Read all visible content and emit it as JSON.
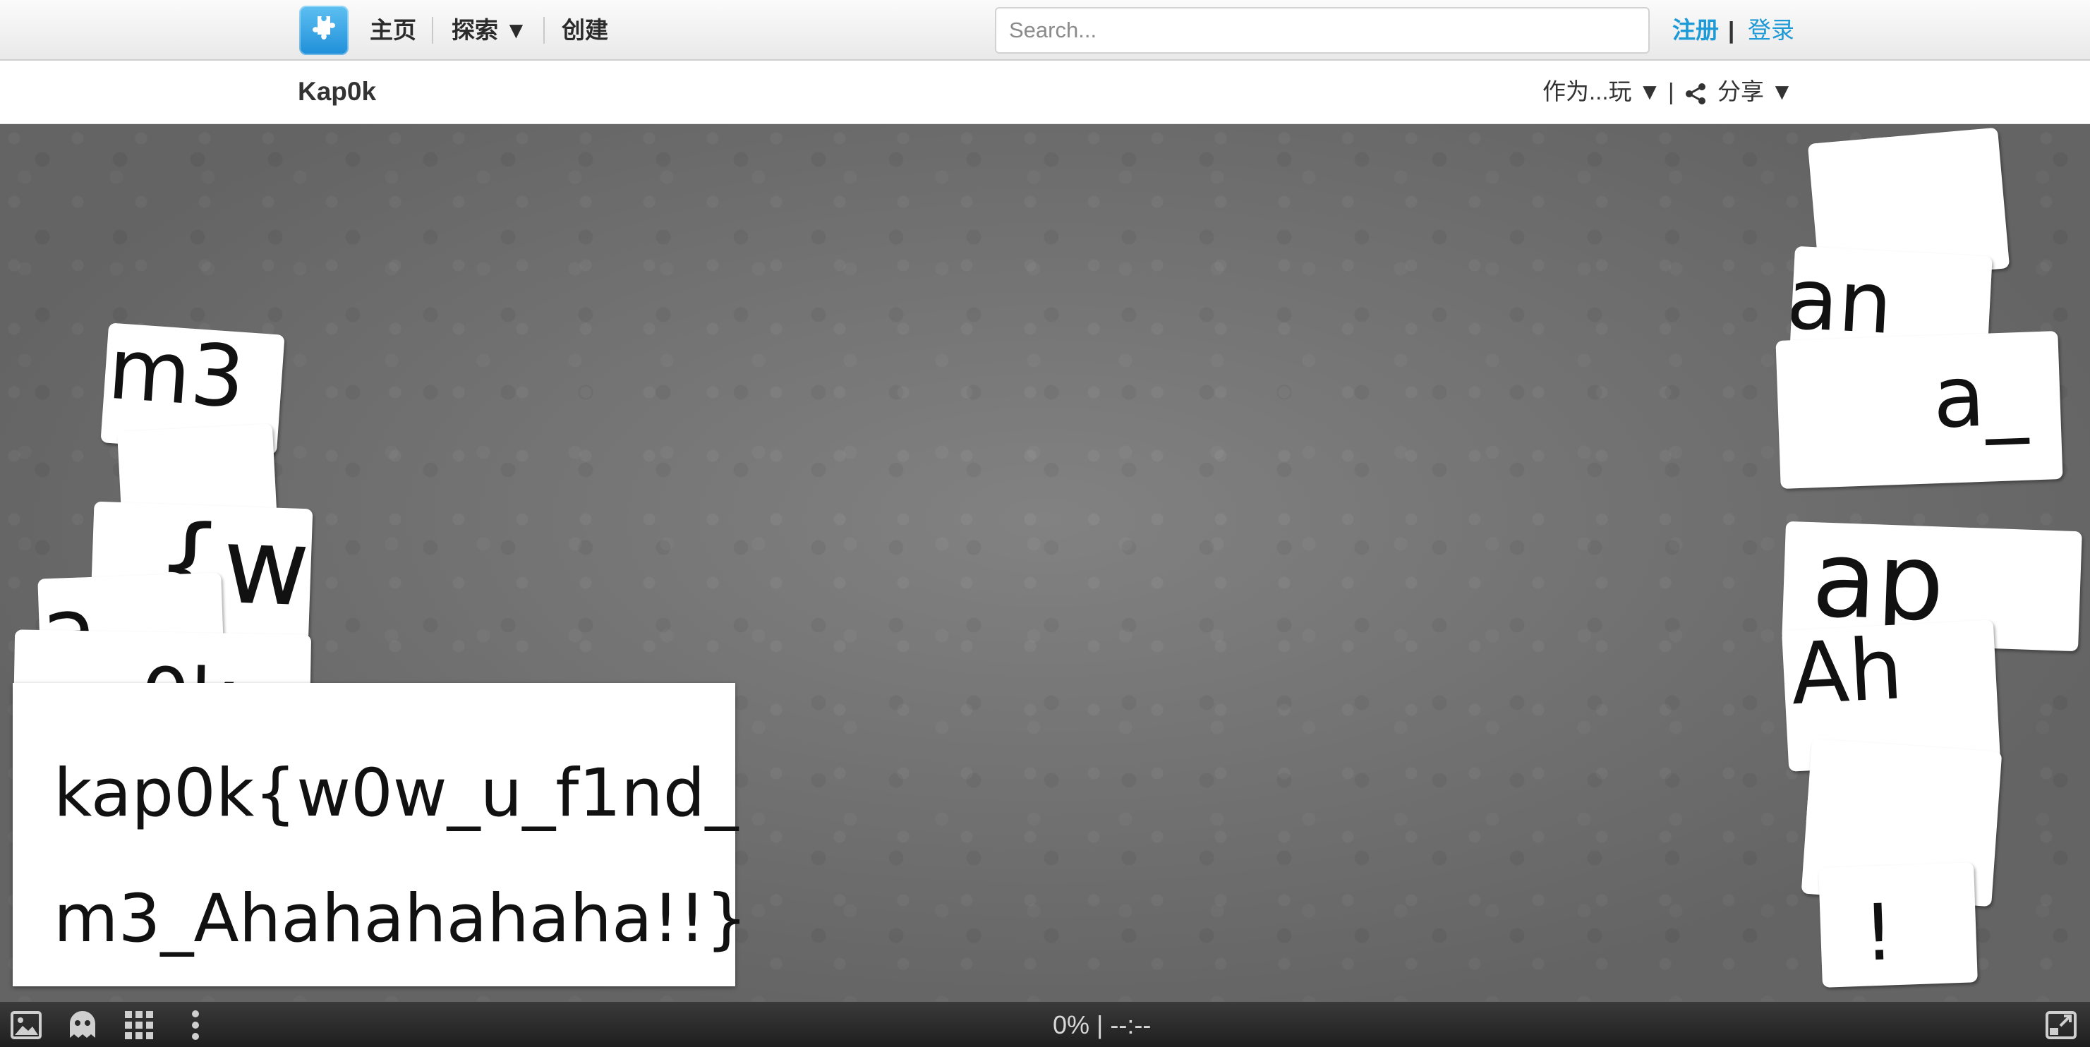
{
  "nav": {
    "logo_icon": "puzzle-piece-icon",
    "home": "主页",
    "explore": "探索 ▼",
    "create": "创建",
    "search_placeholder": "Search...",
    "register": "注册",
    "separator": "|",
    "login": "登录"
  },
  "puzzle": {
    "title": "Kap0k",
    "play_as": "作为...玩 ▼",
    "separator": "|",
    "share": "分享 ▼",
    "share_icon": "share-icon"
  },
  "board": {
    "pieces_left": [
      {
        "text": "m3"
      },
      {
        "text": "{w"
      },
      {
        "text": "a"
      },
      {
        "text": "0k"
      }
    ],
    "pieces_right": [
      {
        "text": "an"
      },
      {
        "text": "a_"
      },
      {
        "text": "ap"
      },
      {
        "text": "Ah"
      },
      {
        "text": "!"
      }
    ],
    "preview_line1": "kap0k{w0w_u_f1nd_",
    "preview_line2": "m3_Ahahahahaha!!}"
  },
  "toolbar": {
    "progress": "0%",
    "separator": "|",
    "timer": "--:--",
    "icons": [
      "image-preview-icon",
      "ghost-icon",
      "grid-icon",
      "more-vertical-icon",
      "fullscreen-icon"
    ]
  },
  "colors": {
    "brand": "#1e9ad6",
    "board": "#7a7a7a",
    "toolbar": "#2a2a2a"
  }
}
